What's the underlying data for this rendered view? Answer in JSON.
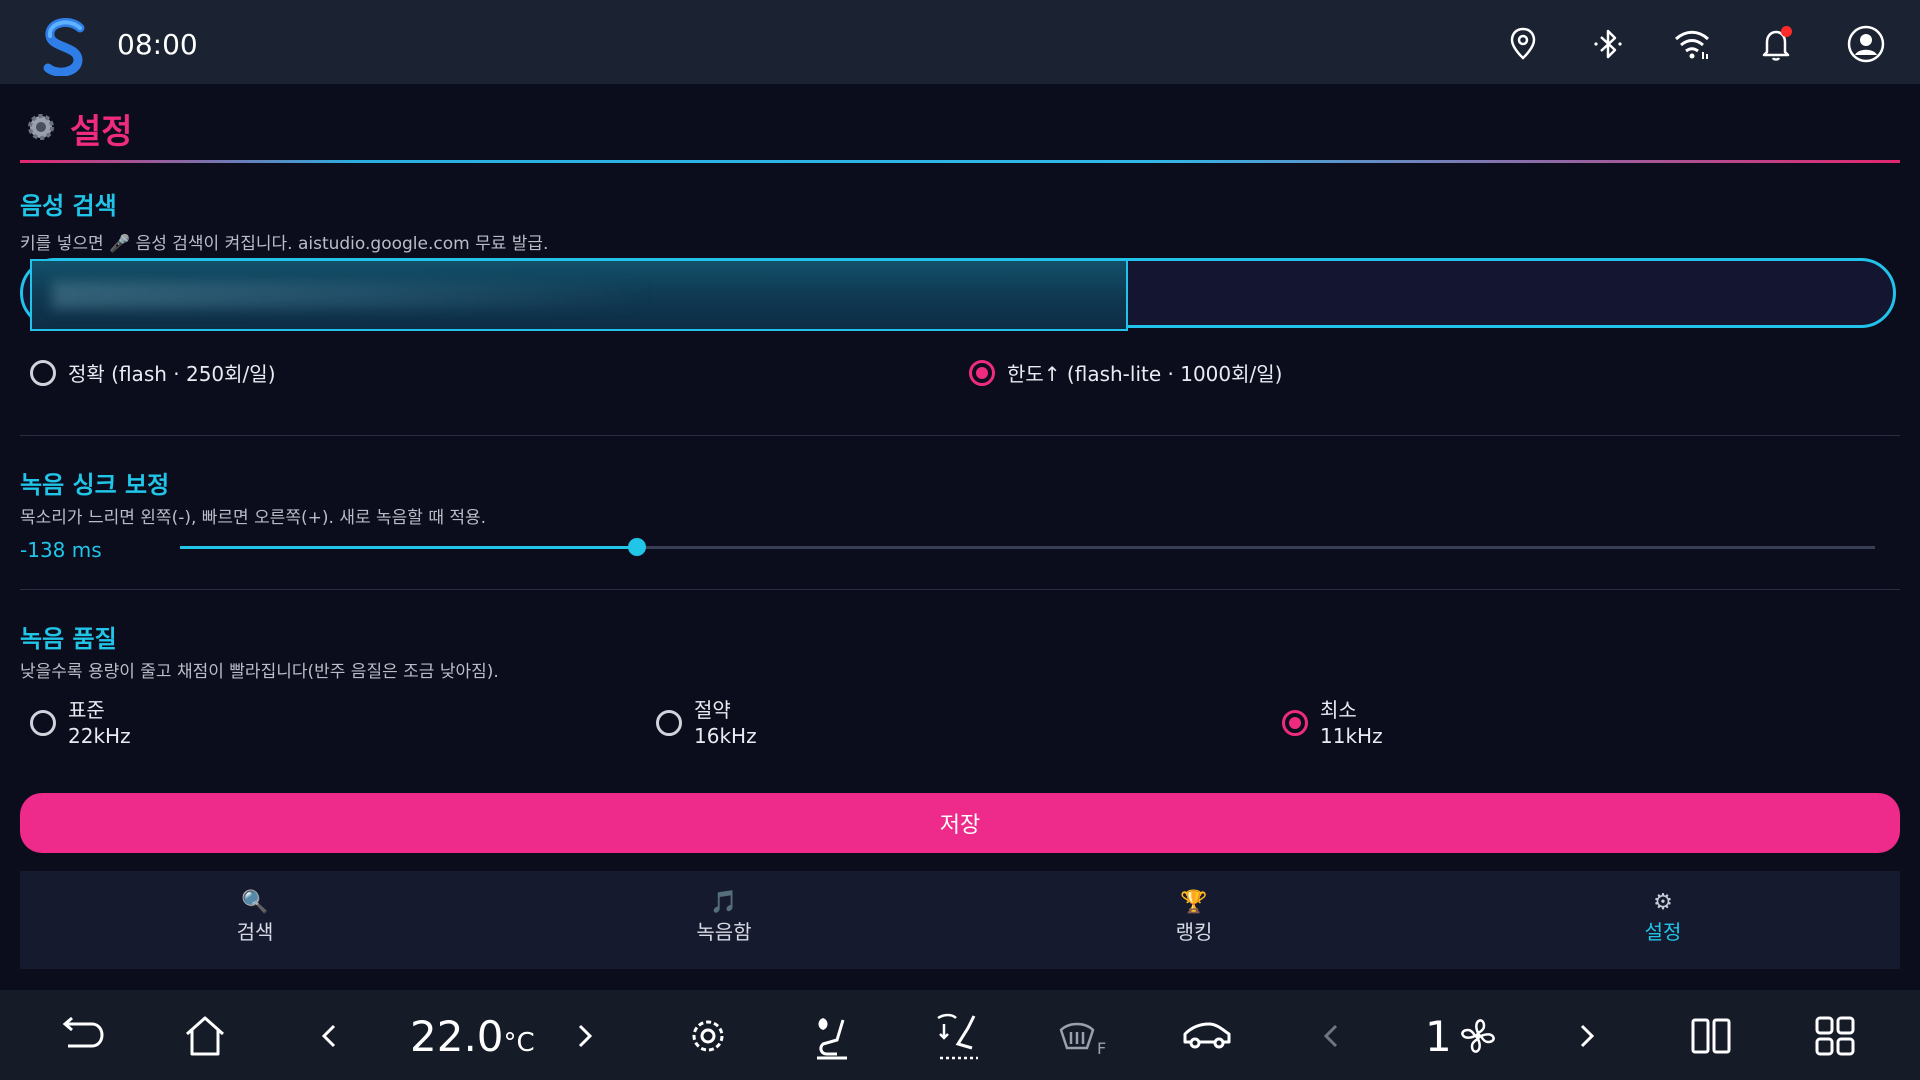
{
  "status": {
    "time": "08:00"
  },
  "page": {
    "title": "설정"
  },
  "voice_search": {
    "heading": "음성 검색",
    "description": "키를 넣으면 🎤 음성 검색이 켜집니다. aistudio.google.com 무료 발급.",
    "key_field_value": "",
    "options": [
      {
        "label": "정확 (flash · 250회/일)",
        "selected": false
      },
      {
        "label": "한도↑ (flash-lite · 1000회/일)",
        "selected": true
      }
    ]
  },
  "sync": {
    "heading": "녹음 싱크 보정",
    "description": "목소리가 느리면 왼쪽(-), 빠르면 오른쪽(+). 새로 녹음할 때 적용.",
    "value_label": "-138 ms",
    "slider_fraction": 0.27
  },
  "quality": {
    "heading": "녹음 품질",
    "description": "낮을수록 용량이 줄고 채점이 빨라집니다(반주 음질은 조금 낮아짐).",
    "options": [
      {
        "name": "표준",
        "rate": "22kHz",
        "selected": false
      },
      {
        "name": "절약",
        "rate": "16kHz",
        "selected": false
      },
      {
        "name": "최소",
        "rate": "11kHz",
        "selected": true
      }
    ]
  },
  "save_label": "저장",
  "tabs": [
    {
      "icon": "🔍",
      "label": "검색",
      "active": false
    },
    {
      "icon": "🎵",
      "label": "녹음함",
      "active": false
    },
    {
      "icon": "🏆",
      "label": "랭킹",
      "active": false
    },
    {
      "icon": "⚙",
      "label": "설정",
      "active": true
    }
  ],
  "climate": {
    "temp_main": "22.0",
    "temp_unit": "°C",
    "fan_speed": "1",
    "defrost_label": "F"
  },
  "colors": {
    "accent_pink": "#ee2b7f",
    "accent_cyan": "#20c5e8",
    "notification_dot": "#ff2a2a"
  }
}
